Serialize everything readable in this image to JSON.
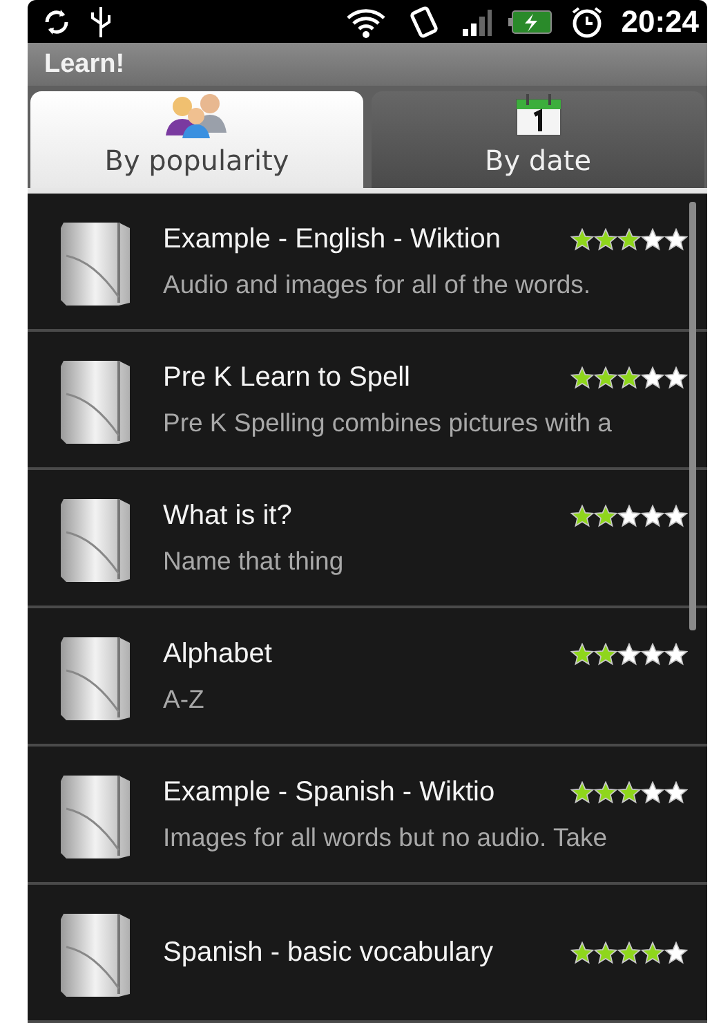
{
  "status_bar": {
    "time": "20:24"
  },
  "window": {
    "title": "Learn!"
  },
  "tabs": [
    {
      "label": "By popularity",
      "selected": true,
      "kind": "people"
    },
    {
      "label": "By date",
      "selected": false,
      "kind": "calendar"
    }
  ],
  "items": [
    {
      "title": "Example - English - Wiktion",
      "description": "Audio and images for all of the words.",
      "stars": 3
    },
    {
      "title": "Pre K Learn to Spell",
      "description": "Pre K Spelling combines pictures with a",
      "stars": 3
    },
    {
      "title": "What is it?",
      "description": "Name that thing",
      "stars": 2
    },
    {
      "title": "Alphabet",
      "description": "A-Z",
      "stars": 2
    },
    {
      "title": "Example - Spanish - Wiktio",
      "description": "Images for all words but no audio. Take",
      "stars": 3
    },
    {
      "title": "Spanish - basic vocabulary",
      "stars": 4
    }
  ]
}
